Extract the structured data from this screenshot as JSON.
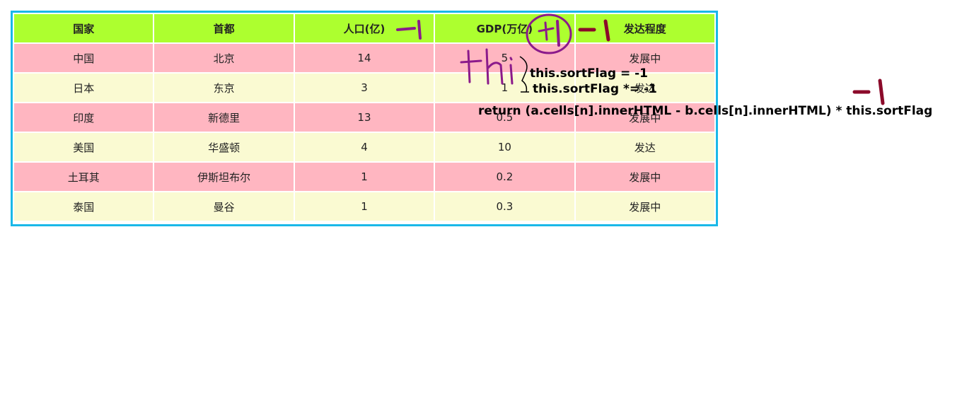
{
  "table": {
    "headers": [
      "国家",
      "首都",
      "人口(亿)",
      "GDP(万亿)",
      "发达程度"
    ],
    "rows": [
      [
        "中国",
        "北京",
        "14",
        "5",
        "发展中"
      ],
      [
        "日本",
        "东京",
        "3",
        "1",
        "发达"
      ],
      [
        "印度",
        "新德里",
        "13",
        "0.5",
        "发展中"
      ],
      [
        "美国",
        "华盛顿",
        "4",
        "10",
        "发达"
      ],
      [
        "土耳其",
        "伊斯坦布尔",
        "1",
        "0.2",
        "发展中"
      ],
      [
        "泰国",
        "曼谷",
        "1",
        "0.3",
        "发展中"
      ]
    ]
  },
  "annotations": {
    "line1": "this.sortFlag = -1",
    "line2": "this.sortFlag *= -1",
    "line3": "return (a.cells[n].innerHTML - b.cells[n].innerHTML) * this.sortFlag"
  },
  "colors": {
    "header_bg": "#adff2f",
    "row_odd_bg": "#ffb6c1",
    "row_even_bg": "#fafad2",
    "frame_border": "#1ab8e8",
    "ink_purple": "#8b1a8b",
    "ink_maroon": "#8b0a2a"
  }
}
